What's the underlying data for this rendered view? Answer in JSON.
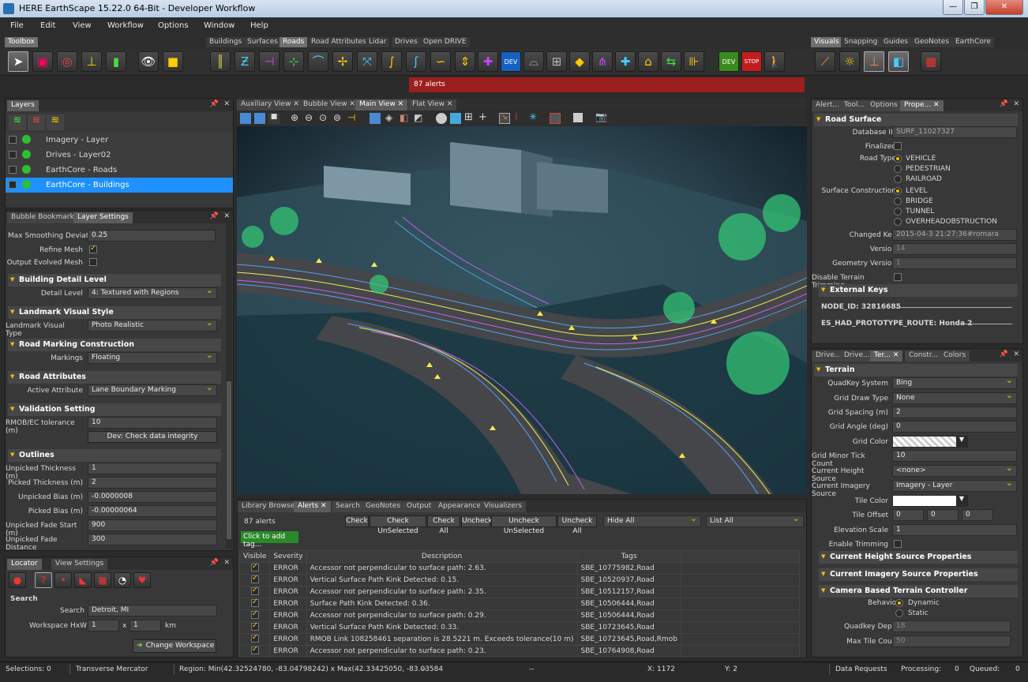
{
  "window": {
    "title": "HERE EarthScape 15.22.0 64-Bit  -  Developer Workflow"
  },
  "menu": [
    "File",
    "Edit",
    "View",
    "Workflow",
    "Options",
    "Window",
    "Help"
  ],
  "toolbar_tabs": {
    "left": [
      "Toolbox"
    ],
    "mid": [
      "Buildings",
      "Surfaces",
      "Roads",
      "Road Attributes",
      "Lidar",
      "Drives",
      "Open DRIVE"
    ],
    "right": [
      "Visuals",
      "Snapping",
      "Guides",
      "GeoNotes",
      "EarthCore"
    ],
    "active": [
      "Toolbox",
      "Roads",
      "Visuals"
    ]
  },
  "alerts_banner": "87 alerts",
  "layers": {
    "tab": "Layers",
    "items": [
      "Imagery - Layer",
      "Drives - Layer02",
      "EarthCore - Roads",
      "EarthCore - Buildings"
    ],
    "selected": 3
  },
  "layer_settings": {
    "tabs": [
      "Bubble Bookmarks",
      "Layer Settings"
    ],
    "max_smoothing_label": "Max Smoothing Deviatio",
    "max_smoothing_value": "0.25",
    "refine_mesh_label": "Refine Mesh",
    "output_evolved_label": "Output Evolved Mesh",
    "building_detail": {
      "title": "Building Detail Level",
      "label": "Detail Level",
      "value": "4: Textured with Regions"
    },
    "landmark": {
      "title": "Landmark Visual Style",
      "label": "Landmark Visual Type",
      "value": "Photo Realistic"
    },
    "road_marking": {
      "title": "Road Marking Construction",
      "label": "Markings",
      "value": "Floating"
    },
    "road_attributes": {
      "title": "Road Attributes",
      "label": "Active Attribute",
      "value": "Lane Boundary Marking"
    },
    "validation": {
      "title": "Validation Setting",
      "label": "RMOB/EC tolerance (m)",
      "value": "10",
      "button": "Dev: Check data integrity"
    },
    "outlines": {
      "title": "Outlines",
      "rows": [
        [
          "Unpicked Thickness (m)",
          "1"
        ],
        [
          "Picked Thickness (m)",
          "2"
        ],
        [
          "Unpicked Bias (m)",
          "-0.0000008"
        ],
        [
          "Picked Bias (m)",
          "-0.00000064"
        ],
        [
          "Unpicked Fade Start (m)",
          "900"
        ],
        [
          "Unpicked Fade Distance",
          "300"
        ]
      ]
    }
  },
  "locator": {
    "tabs": [
      "Locator",
      "View Settings"
    ],
    "search_title": "Search",
    "search_label": "Search",
    "search_value": "Detroit, MI",
    "workspace_label": "Workspace HxW",
    "w1": "1",
    "x": "x",
    "w2": "1",
    "unit": "km",
    "change_button": "Change Workspace"
  },
  "views": {
    "tabs": [
      "Auxiliary View",
      "Bubble View",
      "Main View",
      "Flat View"
    ],
    "active": 2
  },
  "bottom": {
    "tabs": [
      "Library Browser",
      "Alerts",
      "Search",
      "GeoNotes",
      "Output",
      "Appearance",
      "Visualizers"
    ],
    "active": 1,
    "count": "87 alerts",
    "buttons": [
      "Check",
      "Check UnSelected",
      "Check All",
      "Uncheck",
      "Uncheck UnSelected",
      "Uncheck All"
    ],
    "hide": "Hide All",
    "list": "List All",
    "add_tag": "Click to add tag...",
    "columns": [
      "Visible",
      "Severity",
      "Description",
      "Tags"
    ],
    "rows": [
      [
        "ERROR",
        "Accessor not perpendicular to surface path: 2.63.",
        "SBE_10775982,Road"
      ],
      [
        "ERROR",
        "Vertical Surface Path Kink Detected: 0.15.",
        "SBE_10520937,Road"
      ],
      [
        "ERROR",
        "Accessor not perpendicular to surface path: 2.35.",
        "SBE_10512157,Road"
      ],
      [
        "ERROR",
        "Surface Path Kink Detected: 0.36.",
        "SBE_10506444,Road"
      ],
      [
        "ERROR",
        "Accessor not perpendicular to surface path: 0.29.",
        "SBE_10506444,Road"
      ],
      [
        "ERROR",
        "Vertical Surface Path Kink Detected: 0.33.",
        "SBE_10723645,Road"
      ],
      [
        "ERROR",
        "RMOB Link 108258461 separation is 28.5221 m. Exceeds tolerance(10 m)",
        "SBE_10723645,Road,Rmob"
      ],
      [
        "ERROR",
        "Accessor not perpendicular to surface path: 0.23.",
        "SBE_10764908,Road"
      ]
    ]
  },
  "props": {
    "tabs": [
      "Alert...",
      "Tool...",
      "Options",
      "Prope..."
    ],
    "section": "Road Surface",
    "db_label": "Database ID",
    "db_value": "SURF_11027327",
    "finalized": "Finalized",
    "road_type": "Road Type",
    "road_types": [
      "VEHICLE",
      "PEDESTRIAN",
      "RAILROAD"
    ],
    "surface_construction": "Surface Construction",
    "constructions": [
      "LEVEL",
      "BRIDGE",
      "TUNNEL",
      "OVERHEADOBSTRUCTION"
    ],
    "changed_key_label": "Changed Key",
    "changed_key": "2015-04-3 21:27:36#romara",
    "version_label": "Version",
    "version": "14",
    "geom_label": "Geometry Version",
    "geom": "1",
    "disable_terrain": "Disable Terrain Trimming",
    "external": "External Keys",
    "node": "NODE_ID: 32816685",
    "route": "ES_HAD_PROTOTYPE_ROUTE: Honda 2"
  },
  "terrain": {
    "tabs": [
      "Drive...",
      "Drive...",
      "Ter...",
      "Constr...",
      "Colors"
    ],
    "section": "Terrain",
    "rows": [
      [
        "QuadKey System",
        "Bing"
      ],
      [
        "Grid Draw Type",
        "None"
      ],
      [
        "Grid Spacing (m)",
        "2"
      ],
      [
        "Grid Angle (deg)",
        "0"
      ],
      [
        "Grid Color",
        ""
      ],
      [
        "Grid Minor Tick Count",
        "10"
      ],
      [
        "Current Height Source",
        "<none>"
      ],
      [
        "Current Imagery Source",
        "Imagery - Layer"
      ],
      [
        "Tile Color",
        ""
      ],
      [
        "Tile Offset",
        ""
      ],
      [
        "Elevation Scale",
        "1"
      ],
      [
        "Enable Trimming",
        ""
      ]
    ],
    "tile_offset": [
      "0",
      "0",
      "0"
    ],
    "sub": [
      "Current Height Source Properties",
      "Current Imagery Source Properties",
      "Camera Based Terrain Controller"
    ],
    "behavior": "Behavior",
    "behaviors": [
      "Dynamic",
      "Static"
    ],
    "qdepth_label": "Quadkey Depth",
    "qdepth": "18",
    "maxtile_label": "Max Tile Count",
    "maxtile": "50"
  },
  "status": {
    "selections": "Selections: 0",
    "projection": "Transverse Mercator",
    "region": "Region: Min(42.32524780, -83.04798242) x Max(42.33425050, -83.03584",
    "d1": "--",
    "d2": "--",
    "x": "X: 1172",
    "y": "Y: 2",
    "data": "Data Requests",
    "proc": "Processing:",
    "proc_v": "0",
    "queued": "Queued:",
    "queued_v": "0"
  },
  "colors": {
    "accent": "#f0c000",
    "selection": "#1e90ff",
    "alert": "#9b1f1f",
    "layer_dot": "#2ec02e"
  }
}
